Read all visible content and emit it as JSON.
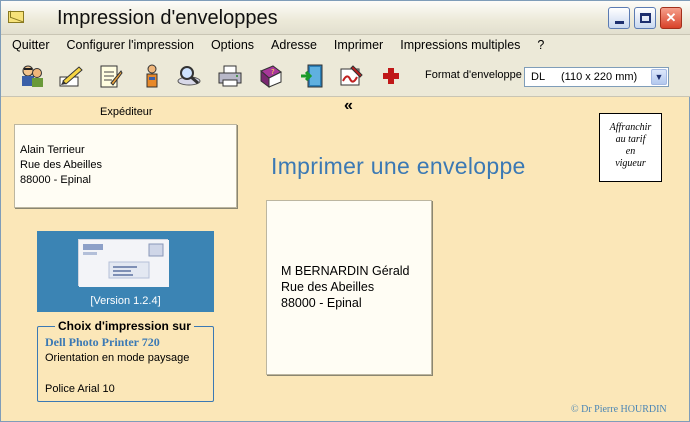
{
  "window": {
    "title": "Impression d'enveloppes",
    "icon": "envelope-icon"
  },
  "menu": [
    "Quitter",
    "Configurer l'impression",
    "Options",
    "Adresse",
    "Imprimer",
    "Impressions multiples",
    "?"
  ],
  "toolbar": {
    "icons": [
      "people-icon",
      "pen-icon",
      "notepad-icon",
      "person-icon",
      "magnifier-icon",
      "printer-icon",
      "book-icon",
      "exit-icon",
      "signature-icon",
      "plus-icon"
    ],
    "format_label": "Format d'enveloppe",
    "format_value_code": "DL",
    "format_value_size": "(110 x 220 mm)"
  },
  "sender": {
    "label": "Expéditeur",
    "lines": [
      "Alain Terrieur",
      "Rue des Abeilles",
      "88000 - Epinal"
    ]
  },
  "chevron": "«",
  "stamp": {
    "lines": [
      "Affranchir",
      "au tarif",
      "en",
      "vigueur"
    ]
  },
  "main_title": "Imprimer une enveloppe",
  "version": "[Version 1.2.4]",
  "print_settings": {
    "title": "Choix d'impression sur",
    "printer": "Dell Photo Printer 720",
    "orientation": "Orientation en mode paysage",
    "font": "Police Arial   10"
  },
  "recipient": {
    "lines": [
      "M  BERNARDIN Gérald",
      "Rue des Abeilles",
      "88000 - Epinal"
    ]
  },
  "copyright": "© Dr Pierre HOURDIN",
  "colors": {
    "background": "#fbe7b8",
    "accent": "#3b79b4",
    "version_panel": "#3b84b4"
  }
}
